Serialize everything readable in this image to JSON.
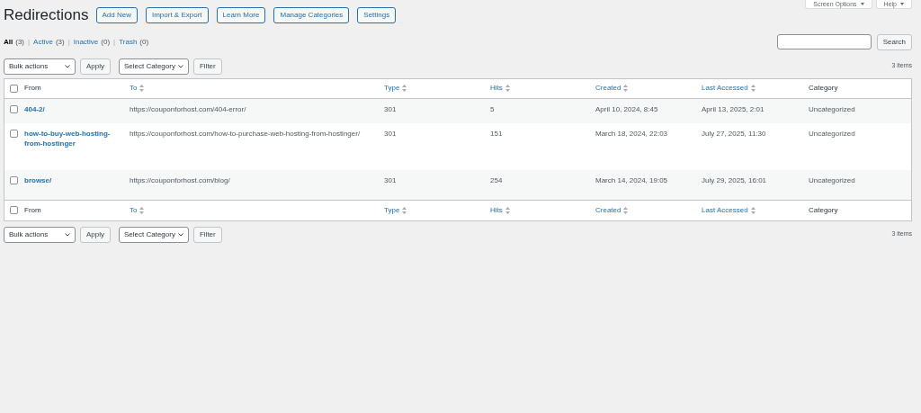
{
  "screen_tabs": [
    {
      "label": "Screen Options"
    },
    {
      "label": "Help"
    }
  ],
  "title": "Redirections",
  "header_buttons": [
    "Add New",
    "Import & Export",
    "Learn More",
    "Manage Categories",
    "Settings"
  ],
  "views": [
    {
      "label": "All",
      "count": "(3)",
      "selected": true
    },
    {
      "separator": "|",
      "label": "Active",
      "count": "(3)",
      "selected": false
    },
    {
      "separator": "|",
      "label": "Inactive",
      "count": "(0)",
      "selected": false
    },
    {
      "separator": "|",
      "label": "Trash",
      "count": "(0)",
      "selected": false
    }
  ],
  "search": {
    "button": "Search"
  },
  "top_toolbar": {
    "bulk_actions": "Bulk actions",
    "apply": "Apply",
    "category": "Select Category",
    "filter": "Filter",
    "count": "3 items"
  },
  "table": {
    "header": [
      {
        "label": "From",
        "sortable": false
      },
      {
        "label": "To",
        "sortable": true
      },
      {
        "label": "Type",
        "sortable": true
      },
      {
        "label": "Hits",
        "sortable": true
      },
      {
        "label": "Created",
        "sortable": true
      },
      {
        "label": "Last Accessed",
        "sortable": true
      },
      {
        "label": "Category",
        "sortable": false
      }
    ],
    "header_checked": false,
    "rows": [
      {
        "checked": false,
        "from": "404-2/",
        "to": "https://couponforhost.com/404-error/",
        "type": "301",
        "hits": "5",
        "created": "April 10, 2024, 8:45",
        "last_accessed": "April 13, 2025, 2:01",
        "category": "Uncategorized"
      },
      {
        "checked": false,
        "from": "how-to-buy-web-hosting-from-hostinger",
        "to": "https://couponforhost.com/how-to-purchase-web-hosting-from-hostinger/",
        "type": "301",
        "hits": "151",
        "created": "March 18, 2024, 22:03",
        "last_accessed": "July 27, 2025, 11:30",
        "category": "Uncategorized"
      },
      {
        "checked": false,
        "from": "browse/",
        "to": "https://couponforhost.com/blog/",
        "type": "301",
        "hits": "254",
        "created": "March 14, 2024, 19:05",
        "last_accessed": "July 29, 2025, 16:01",
        "category": "Uncategorized"
      }
    ],
    "footer": [
      {
        "label": "From",
        "sortable": false
      },
      {
        "label": "To",
        "sortable": true
      },
      {
        "label": "Type",
        "sortable": true
      },
      {
        "label": "Hits",
        "sortable": true
      },
      {
        "label": "Created",
        "sortable": true
      },
      {
        "label": "Last Accessed",
        "sortable": true
      },
      {
        "label": "Category",
        "sortable": false
      }
    ],
    "footer_checked": false
  },
  "bottom_toolbar": {
    "bulk_actions": "Bulk actions",
    "apply": "Apply",
    "category": "Select Category",
    "filter": "Filter",
    "count": "3 items"
  }
}
